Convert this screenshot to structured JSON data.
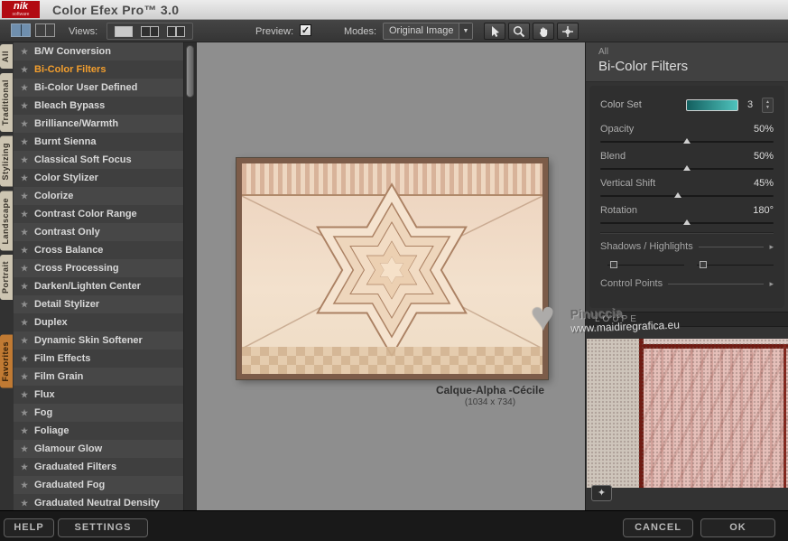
{
  "titlebar": {
    "logo": "nik",
    "logo_sub": "software",
    "title": "Color Efex Pro™ 3.0"
  },
  "toolbar": {
    "views_label": "Views:",
    "preview_label": "Preview:",
    "modes_label": "Modes:",
    "modes_value": "Original Image"
  },
  "category_tabs": {
    "items": [
      {
        "label": "All",
        "accent": false
      },
      {
        "label": "Traditional",
        "accent": false
      },
      {
        "label": "Stylizing",
        "accent": false
      },
      {
        "label": "Landscape",
        "accent": false
      },
      {
        "label": "Portrait",
        "accent": false
      },
      {
        "label": "Favorites",
        "accent": true
      }
    ]
  },
  "filters": {
    "selected": "Bi-Color Filters",
    "items": [
      "B/W Conversion",
      "Bi-Color Filters",
      "Bi-Color User Defined",
      "Bleach Bypass",
      "Brilliance/Warmth",
      "Burnt Sienna",
      "Classical Soft Focus",
      "Color Stylizer",
      "Colorize",
      "Contrast Color Range",
      "Contrast Only",
      "Cross Balance",
      "Cross Processing",
      "Darken/Lighten Center",
      "Detail Stylizer",
      "Duplex",
      "Dynamic Skin Softener",
      "Film Effects",
      "Film Grain",
      "Flux",
      "Fog",
      "Foliage",
      "Glamour Glow",
      "Graduated Filters",
      "Graduated Fog",
      "Graduated Neutral Density"
    ]
  },
  "preview": {
    "caption": "Calque-Alpha -Cécile",
    "dimensions": "(1034 x 734)"
  },
  "panel": {
    "category": "All",
    "title": "Bi-Color Filters",
    "color_set": {
      "label": "Color Set",
      "value": "3",
      "swatch_colors": [
        "#135f5f",
        "#4fc3bd"
      ]
    },
    "sliders": [
      {
        "label": "Opacity",
        "value": "50%",
        "pos": 50
      },
      {
        "label": "Blend",
        "value": "50%",
        "pos": 50
      },
      {
        "label": "Vertical Shift",
        "value": "45%",
        "pos": 45
      },
      {
        "label": "Rotation",
        "value": "180°",
        "pos": 50
      }
    ],
    "sections": {
      "shadows_highlights": "Shadows / Highlights",
      "control_points": "Control Points"
    },
    "loupe_label": "LOUPE"
  },
  "watermark": {
    "name": "Pinuccia",
    "url": "www.maidiregrafica.eu"
  },
  "footer": {
    "help": "HELP",
    "settings": "SETTINGS",
    "cancel": "CANCEL",
    "ok": "OK"
  },
  "icons": {
    "check": "✓",
    "caret_down": "▼",
    "caret_up": "▲",
    "section_arrow": "▸",
    "star": "★",
    "heart": "♥",
    "sparkle": "✦"
  }
}
